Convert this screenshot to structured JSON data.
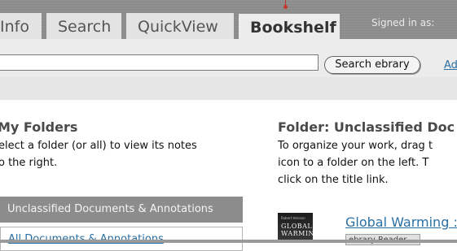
{
  "tabs": [
    {
      "label": "Info",
      "active": false
    },
    {
      "label": "Search",
      "active": false
    },
    {
      "label": "QuickView",
      "active": false
    },
    {
      "label": "Bookshelf",
      "active": true
    }
  ],
  "header": {
    "signed_in_text": "Signed in as:"
  },
  "search": {
    "input_value": "",
    "button_label": "Search ebrary",
    "advanced_link": "Ad"
  },
  "my_folders": {
    "heading": "My Folders",
    "description_line1": "elect a folder (or all) to view its notes",
    "description_line2": "o the right.",
    "items": [
      {
        "label": "Unclassified Documents & Annotations",
        "selected": true
      },
      {
        "label": "All Documents & Annotations",
        "selected": false
      }
    ]
  },
  "folder_view": {
    "heading": "Folder: Unclassified Doc",
    "line1": "To organize your work, drag t",
    "line2": "icon to a folder on the left. T",
    "line3": "click on the title link.",
    "document": {
      "title": "Global Warming :",
      "cover_small": "Robert Henson",
      "cover_title_line1": "GLOBAL",
      "cover_title_line2": "WARMING",
      "badge": "ebrary Reader"
    }
  },
  "colors": {
    "link": "#2a6fa3",
    "topbar": "#8f8f8f",
    "selected_folder": "#8c8c8c"
  }
}
